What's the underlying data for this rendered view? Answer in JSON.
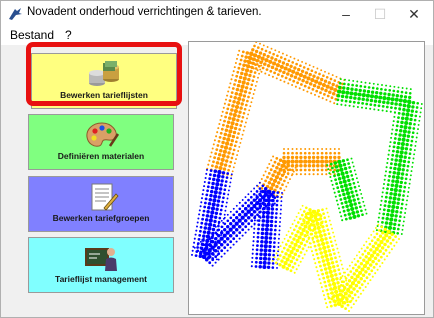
{
  "window": {
    "title": "Novadent onderhoud verrichtingen & tarieven.",
    "icon": "app-icon",
    "controls": {
      "minimize": "–",
      "maximize": "☐",
      "close": "✕"
    }
  },
  "menu": {
    "items": [
      "Bestand",
      "?"
    ]
  },
  "tiles": [
    {
      "label": "Bewerken tarieflijsten",
      "icon": "coins-icon",
      "color": "#ffff80",
      "selected": true
    },
    {
      "label": "Definiëren materialen",
      "icon": "palette-icon",
      "color": "#80ff80",
      "selected": false
    },
    {
      "label": "Bewerken tariefgroepen",
      "icon": "document-pen-icon",
      "color": "#8080ff",
      "selected": false
    },
    {
      "label": "Tarieflijst management",
      "icon": "teacher-icon",
      "color": "#80ffff",
      "selected": false
    }
  ],
  "logo": {
    "name": "tooth-logo",
    "colors": [
      "#ff9900",
      "#0000ff",
      "#ffff00",
      "#00e000"
    ]
  },
  "colors": {
    "highlight": "#e81010"
  }
}
